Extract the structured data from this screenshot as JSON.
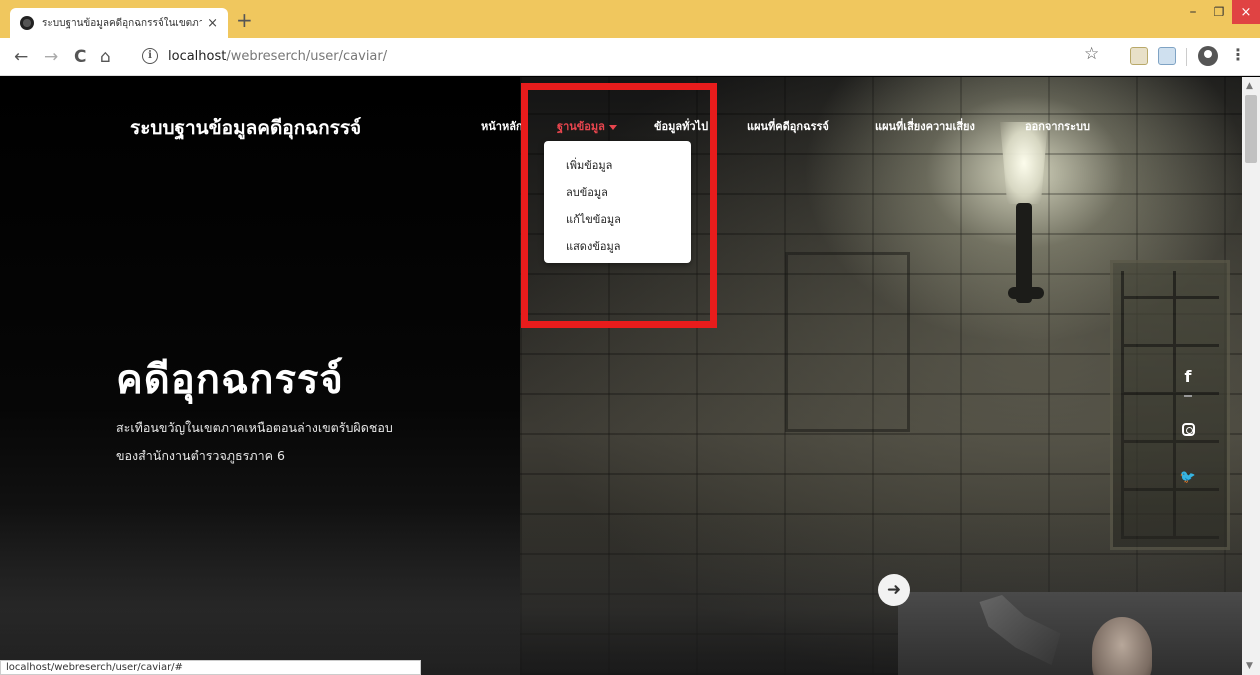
{
  "browser": {
    "tab_title": "ระบบฐานข้อมูลคดีอุกฉกรรจ์ในเขตภาค",
    "tab_close": "×",
    "new_tab": "+",
    "url_host": "localhost",
    "url_path": "/webreserch/user/caviar/",
    "status_url": "localhost/webreserch/user/caviar/#",
    "window_controls": {
      "minimize": "–",
      "maximize": "❐",
      "close": "×"
    },
    "nav_glyphs": {
      "back": "←",
      "forward": "→",
      "reload": "C",
      "home": "⌂",
      "info": "i",
      "star": "☆",
      "menu": "⋮"
    },
    "accent_color": "#f0c75e"
  },
  "site": {
    "brand": "ระบบฐานข้อมูลคดีอุกฉกรรจ์",
    "nav": [
      {
        "label": "หน้าหลัก"
      },
      {
        "label": "ฐานข้อมูล",
        "active": true
      },
      {
        "label": "ข้อมูลทั่วไป"
      },
      {
        "label": "แผนที่คดีอุกฉรรจ์"
      },
      {
        "label": "แผนที่เสี่ยงความเสี่ยง"
      },
      {
        "label": "ออกจากระบบ"
      }
    ],
    "dropdown": [
      "เพิ่มข้อมูล",
      "ลบข้อมูล",
      "แก้ไขข้อมูล",
      "แสดงข้อมูล"
    ],
    "hero": {
      "title": "คดีอุกฉกรรจ์",
      "desc_line1": "สะเทือนขวัญในเขตภาคเหนือตอนล่างเขตรับผิดชอบ",
      "desc_line2": "ของสำนักงานตำรวจภูธรภาค 6"
    },
    "social": {
      "facebook": "f",
      "twitter": "🐦"
    },
    "next_arrow": "➜",
    "active_color": "#e8454e",
    "highlight_color": "#e81c1c"
  }
}
